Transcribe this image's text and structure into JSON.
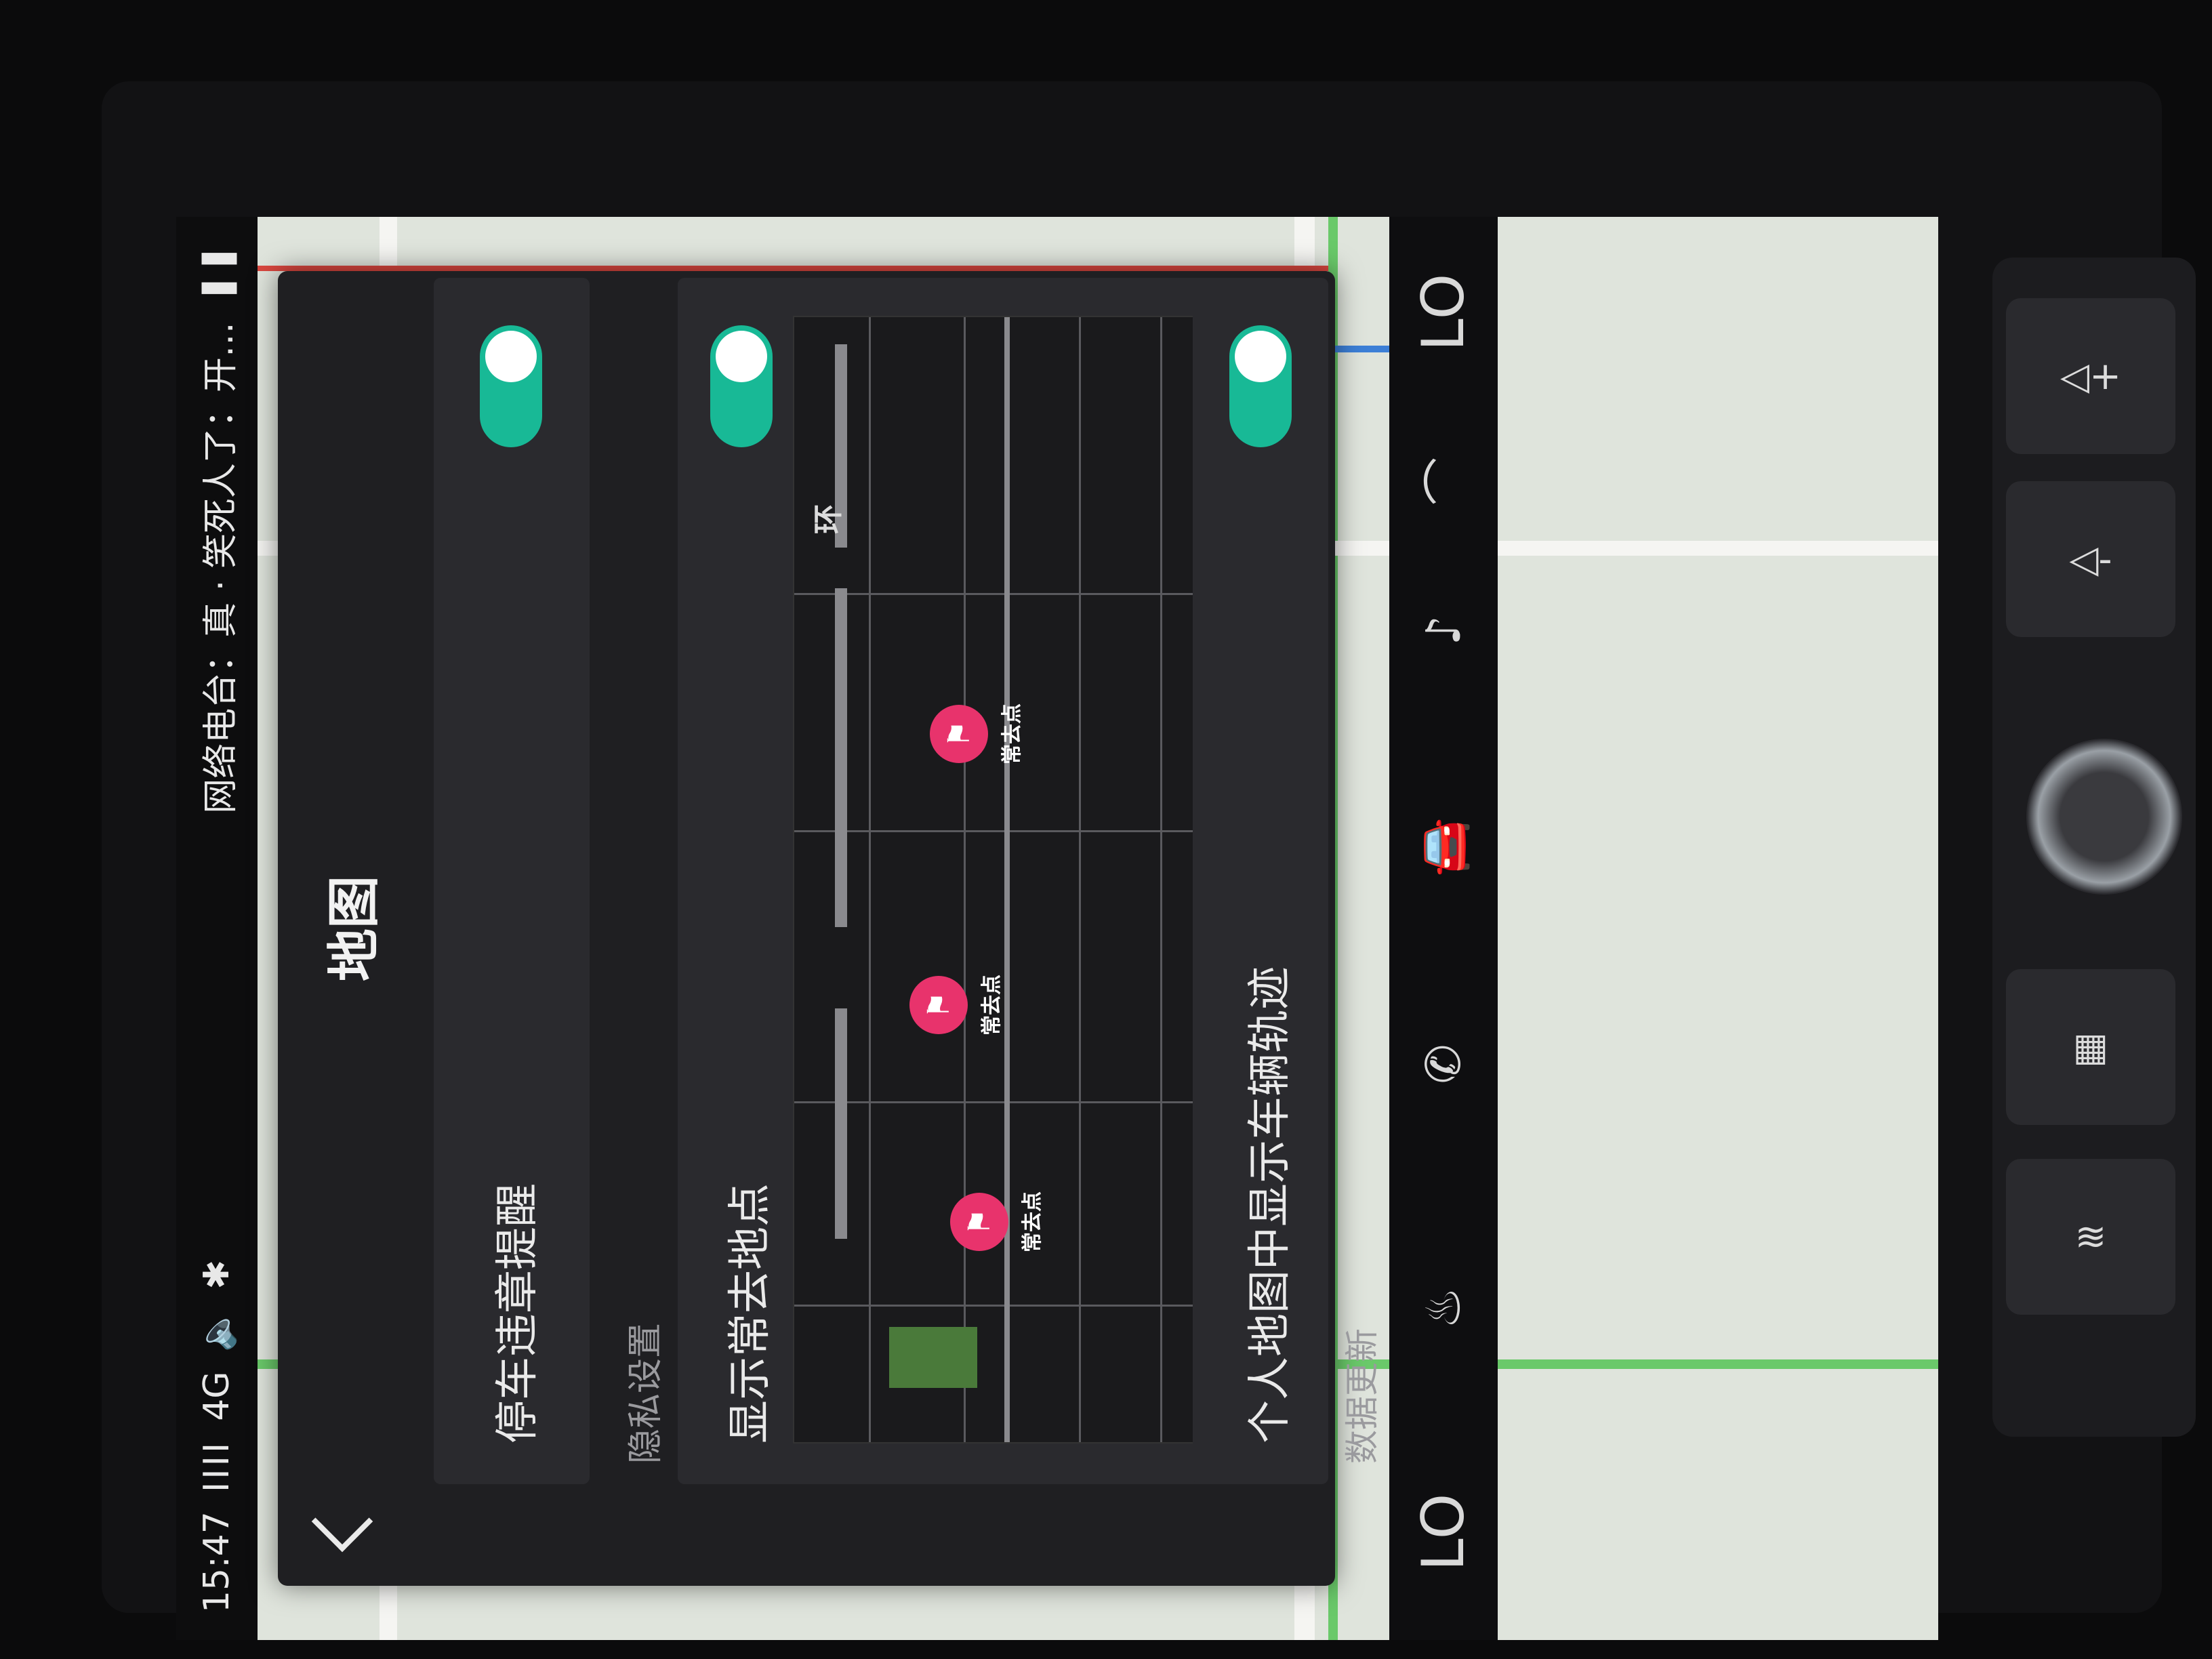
{
  "status_bar": {
    "time": "15:47",
    "signal": "IIII",
    "network": "4G",
    "volume_icon": "speaker-icon",
    "bluetooth_icon": "bluetooth-icon",
    "now_playing": "网络电台：真 · 笑死人了：开…",
    "pause_icon": "pause-icon"
  },
  "panel": {
    "title": "地图",
    "back_icon": "chevron-left-icon",
    "items": [
      {
        "label": "停车违章提醒",
        "toggle": true
      },
      {
        "label": "显示常去地点",
        "toggle": true
      },
      {
        "label": "个人地图中显示车辆轨迹",
        "toggle": true
      }
    ],
    "sections": {
      "privacy": "隐私设置",
      "data_update": "数据更新"
    },
    "illustration": {
      "ring_label": "环",
      "pin_label": "常去点",
      "pins": [
        "常去点",
        "常去点",
        "常去点"
      ]
    }
  },
  "dock": {
    "left_temp": "LO",
    "right_temp": "LO",
    "icons": [
      "seat-heat-icon",
      "phone-icon",
      "car-icon",
      "music-icon",
      "seat-icon"
    ]
  },
  "hardware": {
    "vol_up": "◁+",
    "vol_down": "◁-"
  },
  "colors": {
    "accent": "#18b996",
    "pin": "#e8336c",
    "panel_bg": "#1f1f22"
  }
}
